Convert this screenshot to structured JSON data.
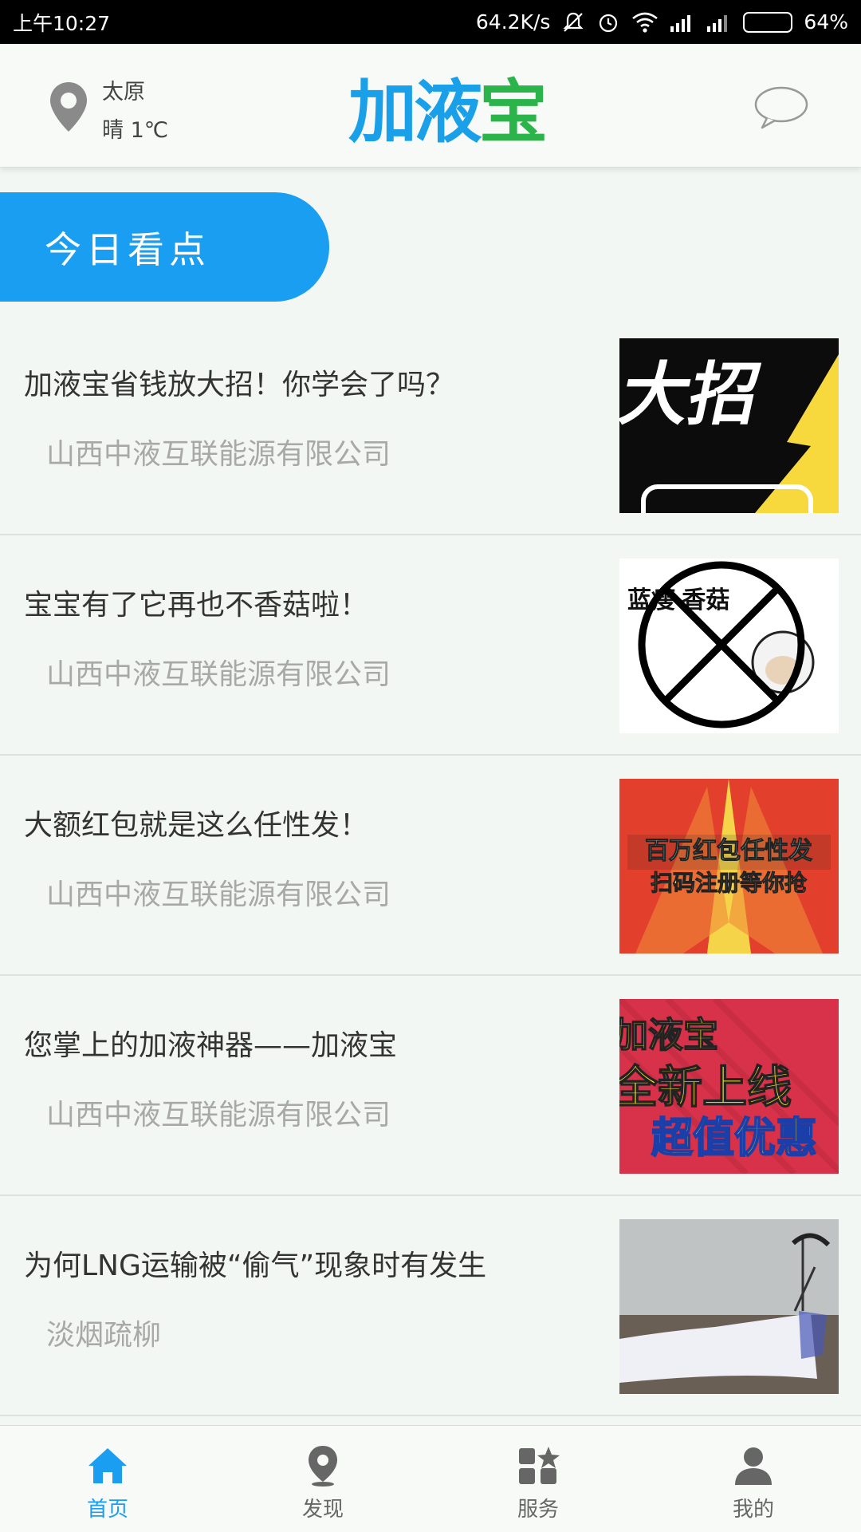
{
  "status_bar": {
    "time": "上午10:27",
    "network_speed": "64.2K/s",
    "battery_percent": "64%",
    "battery_level": 0.64,
    "icons": [
      "mute-icon",
      "alarm-icon",
      "wifi-icon",
      "signal-icon",
      "signal-icon",
      "battery-icon"
    ]
  },
  "header": {
    "city": "太原",
    "weather": "晴 1℃",
    "logo_text_main": "加液宝",
    "icons": {
      "location": "location-pin-icon",
      "message": "message-bubble-icon"
    }
  },
  "section": {
    "title": "今日看点"
  },
  "news": [
    {
      "title": "加液宝省钱放大招！你学会了吗？",
      "source": "山西中液互联能源有限公司",
      "thumb_text": "大招"
    },
    {
      "title": "宝宝有了它再也不香菇啦！",
      "source": "山西中液互联能源有限公司",
      "thumb_text_top": "蓝瘦 香菇"
    },
    {
      "title": "大额红包就是这么任性发！",
      "source": "山西中液互联能源有限公司",
      "thumb_line1": "百万红包任性发",
      "thumb_line2": "扫码注册等你抢"
    },
    {
      "title": "您掌上的加液神器——加液宝",
      "source": "山西中液互联能源有限公司",
      "thumb_line1": "加液宝",
      "thumb_line2": "全新上线",
      "thumb_line3": "超值优惠"
    },
    {
      "title": "为何LNG运输被“偷气”现象时有发生",
      "source": "淡烟疏柳"
    }
  ],
  "bottom_nav": [
    {
      "label": "首页",
      "icon": "home-icon",
      "active": true
    },
    {
      "label": "发现",
      "icon": "location-pin-icon",
      "active": false
    },
    {
      "label": "服务",
      "icon": "services-icon",
      "active": false
    },
    {
      "label": "我的",
      "icon": "user-icon",
      "active": false
    }
  ],
  "colors": {
    "accent": "#1a9ef1",
    "logo_green": "#2bb44a",
    "background": "#f3f7f3",
    "muted_text": "#a8a8a8"
  }
}
